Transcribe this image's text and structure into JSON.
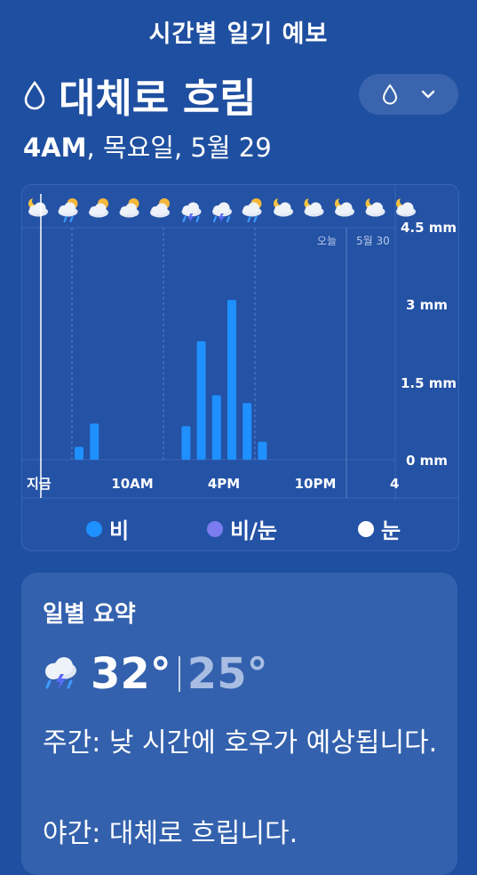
{
  "header": {
    "title": "시간별 일기 예보"
  },
  "condition": {
    "label": "대체로 흐림",
    "icon": "raindrop-icon"
  },
  "dropdown": {
    "icon": "raindrop-icon",
    "chevron": "chevron-down-icon"
  },
  "date_line": {
    "time": "4AM",
    "rest": ", 목요일, 5월 29"
  },
  "chart": {
    "y_labels": [
      "4.5 mm",
      "3 mm",
      "1.5 mm",
      "0 mm"
    ],
    "x_labels": [
      "지금",
      "10AM",
      "4PM",
      "10PM",
      "4"
    ],
    "day_labels": [
      "오늘",
      "5월 30"
    ],
    "hour_icons": [
      "moon-cloud-icon",
      "rain-sun-cloud-icon",
      "sun-cloud-icon",
      "sun-cloud-icon",
      "sun-cloud-icon",
      "thunder-rain-icon",
      "thunder-rain-icon",
      "rain-sun-cloud-icon",
      "moon-cloud-icon",
      "moon-cloud-icon",
      "moon-cloud-icon",
      "moon-cloud-icon",
      "moon-cloud-icon"
    ]
  },
  "chart_data": {
    "type": "bar",
    "ylabel": "",
    "ylim": [
      0,
      4.5
    ],
    "series": [
      {
        "name": "비",
        "color": "#1e90ff",
        "points": [
          {
            "hour": 2,
            "value": 0.25
          },
          {
            "hour": 3,
            "value": 0.7
          },
          {
            "hour": 9,
            "value": 0.65
          },
          {
            "hour": 10,
            "value": 2.3
          },
          {
            "hour": 11,
            "value": 1.25
          },
          {
            "hour": 12,
            "value": 3.1
          },
          {
            "hour": 13,
            "value": 1.1
          },
          {
            "hour": 14,
            "value": 0.35
          }
        ]
      }
    ]
  },
  "legend": [
    {
      "label": "비",
      "color": "#1e90ff"
    },
    {
      "label": "비/눈",
      "color": "#7b7cf0"
    },
    {
      "label": "눈",
      "color": "#ffffff"
    }
  ],
  "summary": {
    "title": "일별 요약",
    "icon": "thunder-rain-icon",
    "high": "32°",
    "low": "25°",
    "day_text": "주간: 낮 시간에 호우가 예상됩니다.",
    "night_text": "야간: 대체로 흐립니다."
  }
}
